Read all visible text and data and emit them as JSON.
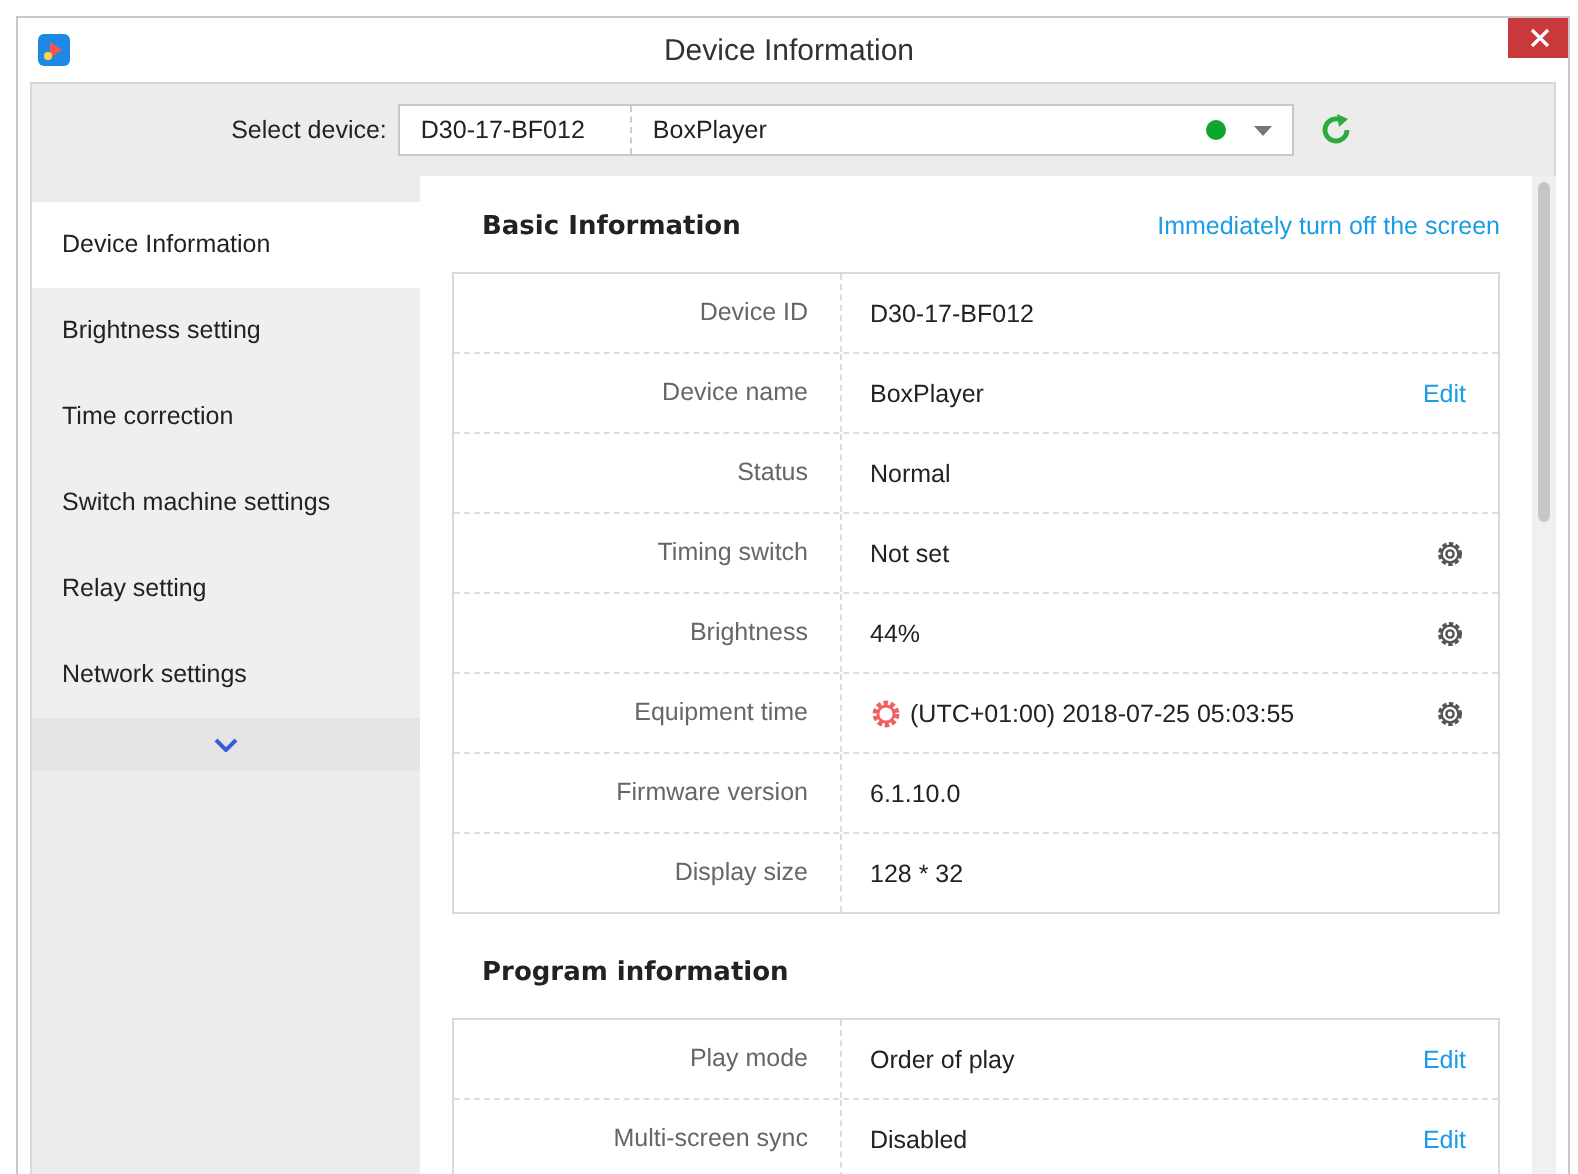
{
  "window": {
    "title": "Device Information"
  },
  "device_selector": {
    "label": "Select device:",
    "device_id": "D30-17-BF012",
    "device_name": "BoxPlayer",
    "online": true
  },
  "sidebar": {
    "items": [
      {
        "label": "Device Information",
        "selected": true
      },
      {
        "label": "Brightness setting",
        "selected": false
      },
      {
        "label": "Time correction",
        "selected": false
      },
      {
        "label": "Switch machine settings",
        "selected": false
      },
      {
        "label": "Relay setting",
        "selected": false
      },
      {
        "label": "Network settings",
        "selected": false
      }
    ]
  },
  "sections": [
    {
      "title": "Basic Information",
      "link": "Immediately turn off the screen",
      "rows": [
        {
          "label": "Device ID",
          "value": "D30-17-BF012",
          "kind": "plain",
          "warning": false
        },
        {
          "label": "Device name",
          "value": "BoxPlayer",
          "kind": "edit",
          "action_text": "Edit",
          "warning": false
        },
        {
          "label": "Status",
          "value": "Normal",
          "kind": "plain",
          "warning": false
        },
        {
          "label": "Timing switch",
          "value": "Not set",
          "kind": "settings",
          "warning": false
        },
        {
          "label": "Brightness",
          "value": "44%",
          "kind": "settings",
          "warning": false
        },
        {
          "label": "Equipment time",
          "value": "(UTC+01:00) 2018-07-25 05:03:55",
          "kind": "settings",
          "warning": true
        },
        {
          "label": "Firmware version",
          "value": "6.1.10.0",
          "kind": "plain",
          "warning": false
        },
        {
          "label": "Display size",
          "value": "128 * 32",
          "kind": "plain",
          "warning": false
        }
      ]
    },
    {
      "title": "Program information",
      "rows": [
        {
          "label": "Play mode",
          "value": "Order of play",
          "kind": "edit",
          "action_text": "Edit",
          "warning": false
        },
        {
          "label": "Multi-screen sync",
          "value": "Disabled",
          "kind": "edit",
          "action_text": "Edit",
          "warning": false
        }
      ]
    }
  ]
}
